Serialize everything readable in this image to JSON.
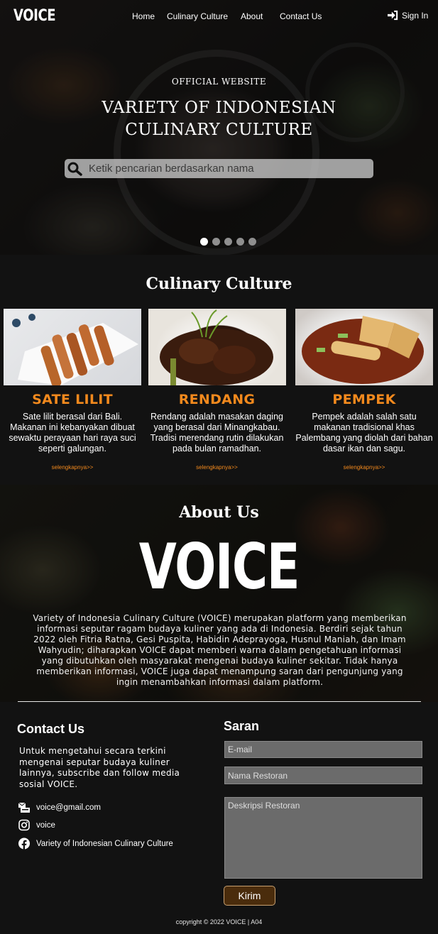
{
  "nav": {
    "logo": "VOICE",
    "links": [
      "Home",
      "Culinary Culture",
      "About",
      "Contact Us"
    ],
    "signin": "Sign In"
  },
  "hero": {
    "subtitle": "OFFICIAL WEBSITE",
    "title_line1": "VARIETY OF INDONESIAN",
    "title_line2": "CULINARY CULTURE",
    "search_placeholder": "Ketik pencarian berdasarkan nama",
    "slides": 5,
    "active_slide": 1
  },
  "culinary": {
    "title": "Culinary Culture",
    "cards": [
      {
        "name": "SATE LILIT",
        "desc": "Sate lilit berasal dari Bali. Makanan ini kebanyakan dibuat sewaktu perayaan hari raya suci seperti galungan.",
        "link": "selengkapnya>>"
      },
      {
        "name": "RENDANG",
        "desc": "Rendang adalah masakan daging yang berasal dari Minangkabau. Tradisi merendang rutin dilakukan pada bulan ramadhan.",
        "link": "selengkapnya>>"
      },
      {
        "name": "PEMPEK",
        "desc": "Pempek adalah salah satu makanan tradisional khas Palembang yang diolah dari bahan dasar ikan dan sagu.",
        "link": "selengkapnya>>"
      }
    ]
  },
  "about": {
    "title": "About Us",
    "logo": "VOICE",
    "text": "Variety of Indonesia Culinary Culture (VOICE) merupakan platform yang memberikan informasi seputar ragam budaya kuliner yang ada di Indonesia. Berdiri sejak tahun 2022 oleh Fitria Ratna, Gesi Puspita, Habidin Adeprayoga, Husnul Maniah, dan Imam Wahyudin; diharapkan VOICE dapat memberi warna dalam pengetahuan informasi yang dibutuhkan oleh masyarakat mengenai budaya kuliner sekitar. Tidak hanya memberikan informasi, VOICE juga dapat menampung saran dari pengunjung yang ingin menambahkan informasi dalam platform."
  },
  "contact": {
    "title": "Contact Us",
    "desc": "Untuk mengetahui secara terkini mengenai  seputar budaya kuliner lainnya, subscribe dan follow media sosial VOICE.",
    "email": "voice@gmail.com",
    "instagram": "voice",
    "facebook": "Variety of Indonesian Culinary Culture"
  },
  "saran": {
    "title": "Saran",
    "email_placeholder": "E-mail",
    "restaurant_placeholder": "Nama Restoran",
    "description_placeholder": "Deskripsi Restoran",
    "submit": "Kirim"
  },
  "footer": {
    "copyright": "copyright © 2022 VOICE | A04"
  },
  "colors": {
    "accent": "#f2891d",
    "background": "#121212",
    "button": "#4a2c0c"
  },
  "icons": [
    "sign-in-icon",
    "search-icon",
    "email-icon",
    "instagram-icon",
    "facebook-icon"
  ]
}
